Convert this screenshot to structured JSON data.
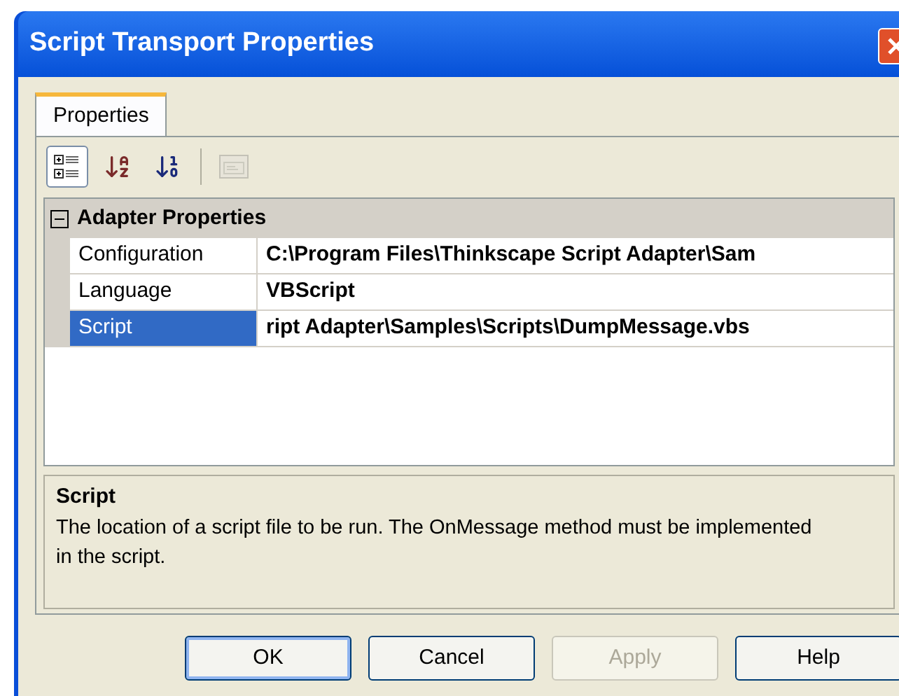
{
  "window": {
    "title": "Script Transport Properties"
  },
  "tabs": [
    {
      "label": "Properties",
      "selected": true
    }
  ],
  "toolbar": [
    {
      "kind": "categorized",
      "selected": true,
      "disabled": false
    },
    {
      "kind": "alphabetical",
      "selected": false,
      "disabled": false
    },
    {
      "kind": "numbered",
      "selected": false,
      "disabled": false
    },
    {
      "kind": "pages",
      "selected": false,
      "disabled": true
    }
  ],
  "grid": {
    "category": {
      "label": "Adapter Properties",
      "expanded": true
    },
    "rows": [
      {
        "name": "Configuration",
        "value": "C:\\Program Files\\Thinkscape Script Adapter\\Sam",
        "selected": false
      },
      {
        "name": "Language",
        "value": "VBScript",
        "selected": false
      },
      {
        "name": "Script",
        "value": "ript Adapter\\Samples\\Scripts\\DumpMessage.vbs",
        "selected": true
      }
    ]
  },
  "help": {
    "title": "Script",
    "text": "The location of a script file to be run. The OnMessage method must be implemented in the script."
  },
  "buttons": [
    {
      "label": "OK",
      "default": true,
      "disabled": false
    },
    {
      "label": "Cancel",
      "default": false,
      "disabled": false
    },
    {
      "label": "Apply",
      "default": false,
      "disabled": true
    },
    {
      "label": "Help",
      "default": false,
      "disabled": false
    }
  ]
}
